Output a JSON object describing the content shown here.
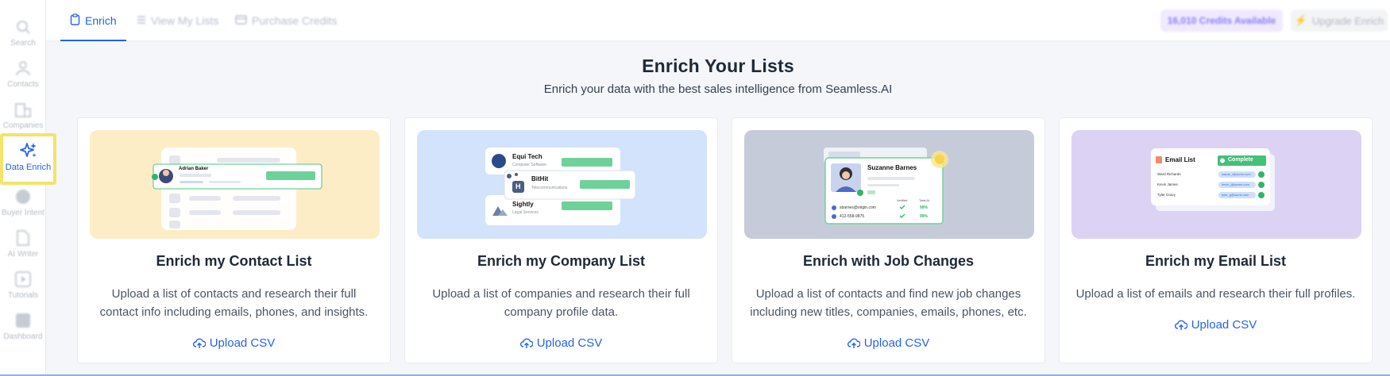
{
  "sidebar": {
    "items": [
      {
        "label": "Search",
        "icon": "search-icon"
      },
      {
        "label": "Contacts",
        "icon": "contacts-icon"
      },
      {
        "label": "Companies",
        "icon": "companies-icon"
      },
      {
        "label": "Data Enrich",
        "icon": "sparkles-icon"
      },
      {
        "label": "Buyer Intent",
        "icon": "intent-icon"
      },
      {
        "label": "AI Writer",
        "icon": "document-icon"
      },
      {
        "label": "Tutorials",
        "icon": "play-icon"
      },
      {
        "label": "Dashboard",
        "icon": "dashboard-icon"
      }
    ]
  },
  "tabs": {
    "enrich": "Enrich",
    "view_lists": "View My Lists",
    "purchase": "Purchase Credits"
  },
  "topbar": {
    "credits": "16,010 Credits Available",
    "upgrade": "Upgrade Enrich"
  },
  "hero": {
    "title": "Enrich Your Lists",
    "subtitle": "Enrich your data with the best sales intelligence from Seamless.AI"
  },
  "cards": [
    {
      "title": "Enrich my Contact List",
      "desc": "Upload a list of contacts and research their full contact info including emails, phones, and insights.",
      "cta": "Upload CSV",
      "illustration": {
        "name": "Adrian Baker"
      }
    },
    {
      "title": "Enrich my Company List",
      "desc": "Upload a list of companies and research their full company profile data.",
      "cta": "Upload CSV",
      "illustration": {
        "company1": "Equi Tech",
        "company1_sub": "Computer Software",
        "company2": "BitHit",
        "company2_sub": "Telecommunications",
        "company3": "Sightly",
        "company3_sub": "Legal Services",
        "logo_letter": "H"
      }
    },
    {
      "title": "Enrich with Job Changes",
      "desc": "Upload a list of contacts and find new job changes including new titles, companies, emails, phones, etc.",
      "cta": "Upload CSV",
      "illustration": {
        "name": "Suzanne Barnes",
        "col1": "Verified",
        "col2": "Total AI",
        "email": "sbarnes@origin.com",
        "phone": "412-558-9875",
        "pct1": "99%",
        "pct2": "99%"
      }
    },
    {
      "title": "Enrich my Email List",
      "desc": "Upload a list of emails and research their full profiles.",
      "cta": "Upload CSV",
      "illustration": {
        "heading": "Email List",
        "status": "Complete",
        "rows": [
          "Ward Richards",
          "Kevin James",
          "Tyler Gracy"
        ],
        "emails": [
          "wards_r@acme.com",
          "kevin_j@acme.com",
          "tyler_g@acme.com"
        ]
      }
    }
  ],
  "colors": {
    "accent": "#2563eb",
    "highlight": "#f4e36c",
    "card1_bg": "#fdedc7",
    "card2_bg": "#d3e3fb",
    "card3_bg": "#c6cbda",
    "card4_bg": "#dcd3f4",
    "green": "#6fd19a"
  }
}
